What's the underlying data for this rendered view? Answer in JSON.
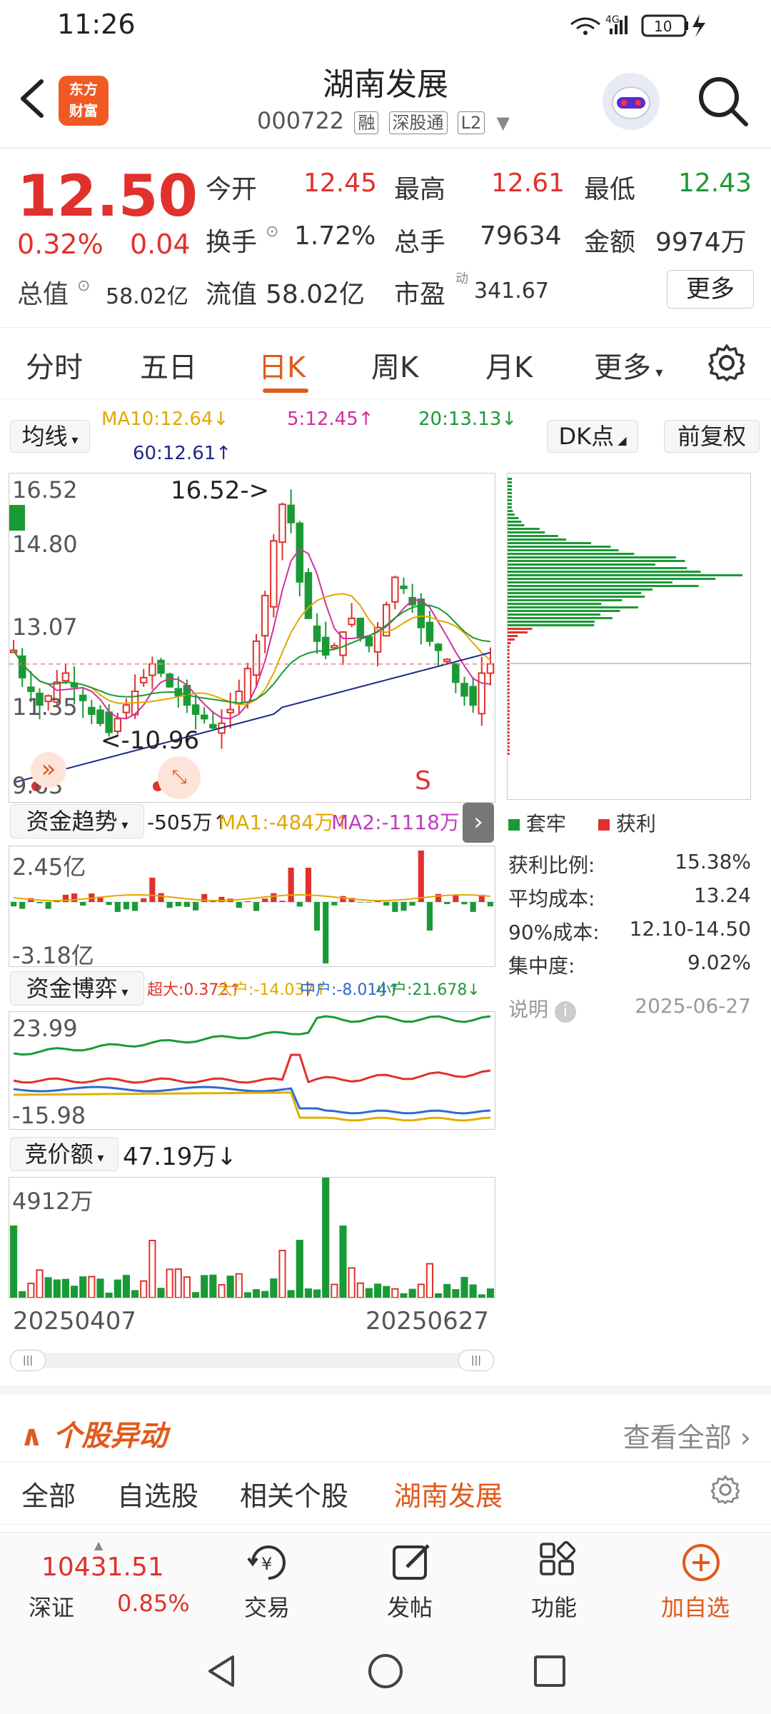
{
  "status": {
    "time": "11:26",
    "network": "4G",
    "battery": "10"
  },
  "header": {
    "logo_line1": "东方",
    "logo_line2": "财富",
    "stock_name": "湖南发展",
    "stock_code": "000722",
    "tags": [
      "融",
      "深股通",
      "L2"
    ]
  },
  "quote": {
    "price": "12.50",
    "change_pct": "0.32%",
    "change": "0.04",
    "open_label": "今开",
    "open": "12.45",
    "high_label": "最高",
    "high": "12.61",
    "low_label": "最低",
    "low": "12.43",
    "turnover_label": "换手",
    "turnover": "1.72%",
    "volume_label": "总手",
    "volume": "79634",
    "amount_label": "金额",
    "amount": "9974万",
    "mktcap_label": "总值",
    "mktcap": "58.02亿",
    "float_label": "流值",
    "float": "58.02亿",
    "pe_label": "市盈",
    "pe_sup": "动",
    "pe": "341.67",
    "more": "更多"
  },
  "tabs": [
    "分时",
    "五日",
    "日K",
    "周K",
    "月K",
    "更多"
  ],
  "active_tab": "日K",
  "kline": {
    "ma_button": "均线",
    "ma10": "MA10:12.64↓",
    "ma5": "5:12.45↑",
    "ma20": "20:13.13↓",
    "ma60": "60:12.61↑",
    "dk_button": "DK点",
    "adjust_button": "前复权",
    "y_ticks": [
      "16.52",
      "14.80",
      "13.07",
      "11.35",
      "9.63"
    ],
    "high_note": "16.52->",
    "low_note": "<-10.96",
    "sell_mark": "S",
    "ma_colors": {
      "ma5": "#d1309b",
      "ma10": "#e0a800",
      "ma20": "#1a9a36",
      "ma60": "#1c2a8a"
    }
  },
  "chip_dist": {
    "legend_trapped": "套牢",
    "legend_profit": "获利",
    "rows": [
      {
        "label": "获利比例:",
        "value": "15.38%"
      },
      {
        "label": "平均成本:",
        "value": "13.24"
      },
      {
        "label": "90%成本:",
        "value": "12.10-14.50"
      },
      {
        "label": "集中度:",
        "value": "9.02%"
      }
    ],
    "note_label": "说明",
    "date": "2025-06-27"
  },
  "fund_trend": {
    "selector": "资金趋势",
    "value": "-505万↑",
    "ma1": "MA1:-484万↑",
    "ma2": "MA2:-1118万↑",
    "y_top": "2.45亿",
    "y_bottom": "-3.18亿"
  },
  "fund_game": {
    "selector": "资金博弈",
    "super": "超大:0.372↑",
    "large": "大户:-14.037↑",
    "medium": "中户:-8.014↑",
    "small": "小户:21.678↓",
    "y_top": "23.99",
    "y_bottom": "-15.98"
  },
  "auction": {
    "selector": "竞价额",
    "value": "47.19万↓",
    "y_top": "4912万",
    "date_start": "20250407",
    "date_end": "20250627"
  },
  "movers": {
    "title": "个股异动",
    "view_all": "查看全部",
    "tabs": [
      "全部",
      "自选股",
      "相关个股",
      "湖南发展"
    ]
  },
  "bottom_bar": {
    "index_value": "10431.51",
    "index_name": "深证",
    "index_pct": "0.85%",
    "trade": "交易",
    "post": "发帖",
    "func": "功能",
    "add": "加自选"
  },
  "chart_data": {
    "type": "candlestick",
    "title": "",
    "y_range": [
      9.63,
      16.52
    ],
    "x_range": [
      "20250407",
      "20250627"
    ]
  }
}
